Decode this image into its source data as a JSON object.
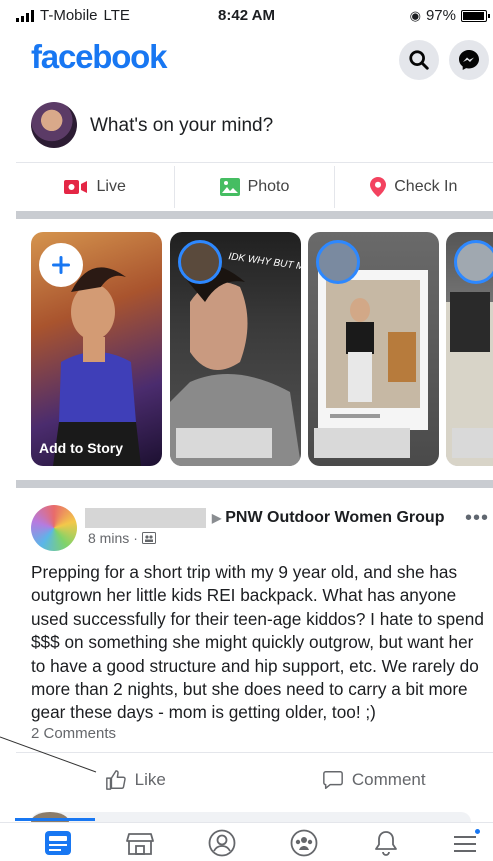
{
  "status_bar": {
    "carrier": "T-Mobile",
    "network": "LTE",
    "time": "8:42 AM",
    "battery": "97%",
    "battery_level": 0.97
  },
  "header": {
    "logo": "facebook",
    "icons": [
      "search-icon",
      "messenger-icon"
    ]
  },
  "composer": {
    "placeholder": "What's on your mind?"
  },
  "quick_actions": [
    {
      "label": "Live",
      "icon": "live-video-icon",
      "color": "#e42645"
    },
    {
      "label": "Photo",
      "icon": "photo-icon",
      "color": "#45bd62"
    },
    {
      "label": "Check In",
      "icon": "location-pin-icon",
      "color": "#f3425f"
    }
  ],
  "stories": {
    "add_label": "Add to Story",
    "items": [
      {
        "overlay_text": "IDK WHY BUT MOOD"
      },
      {
        "overlay_text": ""
      },
      {
        "overlay_text": ""
      }
    ]
  },
  "post": {
    "group_name": "PNW Outdoor Women Group",
    "time": "8 mins",
    "body": "Prepping for a short trip with my 9 year old, and she has outgrown her little kids REI backpack. What has anyone used successfully for their teen-age kiddos? I hate to spend $$$ on something she might quickly outgrow, but want her to have a good structure and hip support, etc. We rarely do more than 2 nights, but she does need to carry a bit more gear these days - mom is getting older, too! ;)",
    "comments_count": "2 Comments",
    "actions": {
      "like": "Like",
      "comment": "Comment"
    }
  },
  "tab_bar": {
    "tabs": [
      "news-feed-icon",
      "marketplace-icon",
      "profile-icon",
      "groups-icon",
      "notifications-icon",
      "menu-icon"
    ],
    "active": "news-feed-icon",
    "accent": "#1877f2"
  }
}
